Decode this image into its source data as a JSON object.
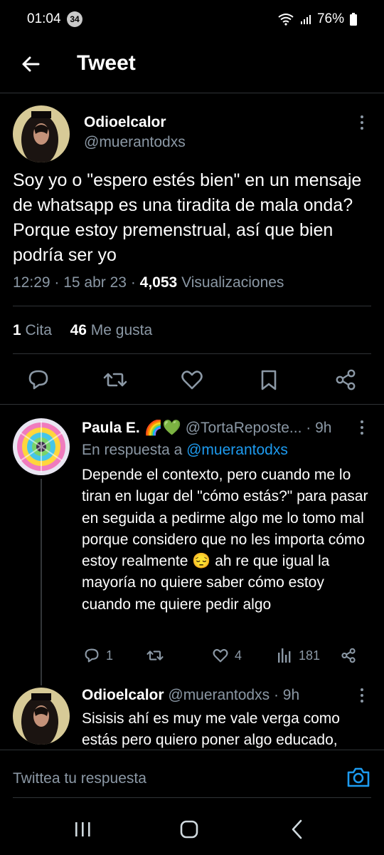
{
  "status_bar": {
    "time": "01:04",
    "badge": "34",
    "battery": "76%"
  },
  "header": {
    "title": "Tweet"
  },
  "tweet": {
    "name": "Odioelcalor",
    "handle": "@muerantodxs",
    "text": "Soy yo o \"espero estés bien\" en un mensaje de whatsapp es una tiradita de mala onda? Porque estoy premenstrual, así que bien podría ser yo",
    "time": "12:29",
    "date": "15 abr 23",
    "views": "4,053",
    "views_label": "Visualizaciones",
    "quotes": "1",
    "quotes_label": "Cita",
    "likes": "46",
    "likes_label": "Me gusta"
  },
  "reply": {
    "name": "Paula E.",
    "emoji": "🌈💚",
    "handle": "@TortaReposte...",
    "age": "9h",
    "replying_to_label": "En respuesta a",
    "replying_to_handle": "@muerantodxs",
    "text": "Depende el contexto, pero cuando me lo tiran en lugar del \"cómo estás?\" para pasar en seguida a pedirme algo me lo tomo mal porque considero que no les importa cómo estoy realmente 😔 ah re que igual la mayoría no quiere saber cómo estoy cuando me quiere pedir algo",
    "replies": "1",
    "likes": "4",
    "views": "181"
  },
  "reply2": {
    "name": "Odioelcalor",
    "handle": "@muerantodxs",
    "age": "9h",
    "text": "Sisisis ahí es muy me vale verga como estás pero quiero poner algo educado,"
  },
  "composer": {
    "placeholder": "Twittea tu respuesta"
  },
  "colors": {
    "accent": "#1d9bf0",
    "muted": "#8b98a5",
    "background": "#000000"
  }
}
